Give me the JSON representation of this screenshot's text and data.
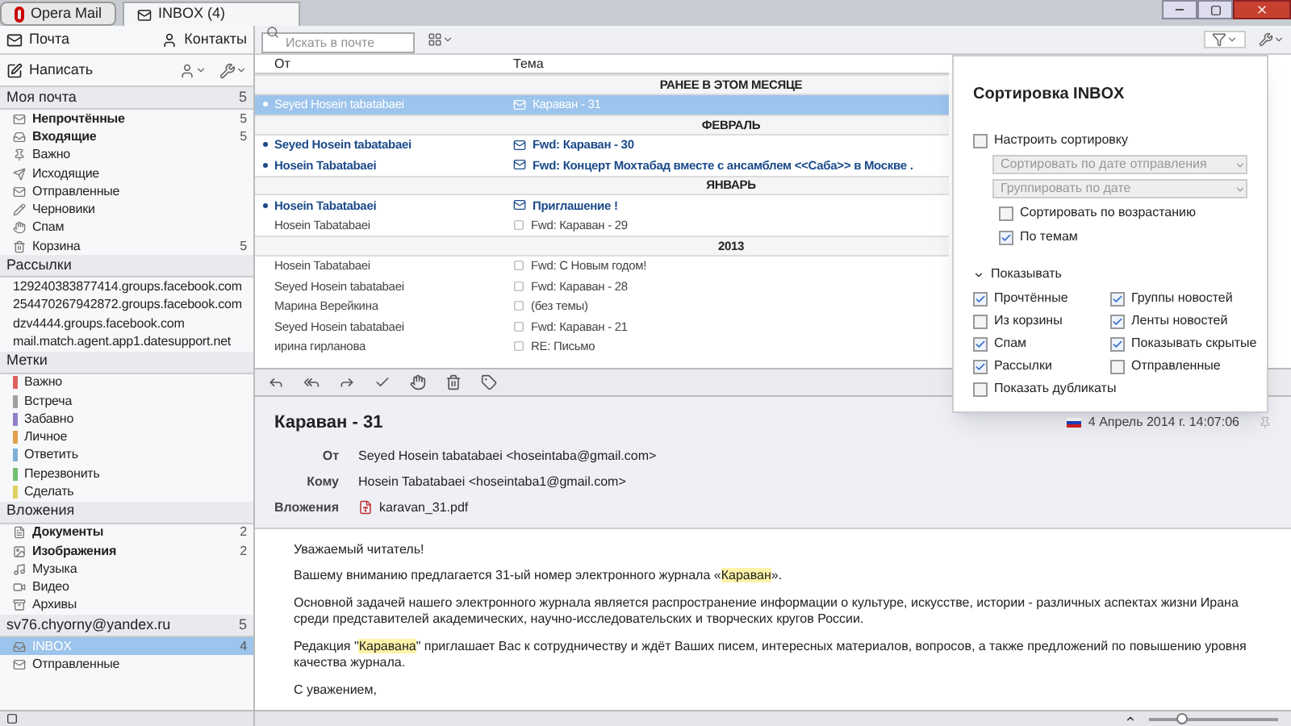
{
  "app_tabs": [
    {
      "label": "Opera Mail",
      "kind": "app"
    },
    {
      "label": "INBOX (4)",
      "kind": "tab"
    }
  ],
  "nav": {
    "mail": "Почта",
    "contacts": "Контакты",
    "compose": "Написать"
  },
  "sidebar": [
    {
      "title": "Моя почта",
      "count": "5",
      "items": [
        {
          "label": "Непрочтённые",
          "bold": true,
          "count": "5",
          "kind": "unread"
        },
        {
          "label": "Входящие",
          "bold": true,
          "count": "5",
          "kind": "inbox"
        },
        {
          "label": "Важно",
          "bold": false,
          "kind": "important"
        },
        {
          "label": "Исходящие",
          "bold": false,
          "kind": "outbox"
        },
        {
          "label": "Отправленные",
          "bold": false,
          "kind": "sent"
        },
        {
          "label": "Черновики",
          "bold": false,
          "kind": "drafts"
        },
        {
          "label": "Спам",
          "bold": false,
          "kind": "spam"
        },
        {
          "label": "Корзина",
          "bold": false,
          "count": "5",
          "kind": "trash"
        }
      ]
    },
    {
      "title": "Рассылки",
      "items": [
        {
          "label": "129240383877414.groups.facebook.com",
          "bold": false
        },
        {
          "label": "254470267942872.groups.facebook.com",
          "bold": false
        },
        {
          "label": "dzv4444.groups.facebook.com",
          "bold": false
        },
        {
          "label": "mail.match.agent.app1.datesupport.net",
          "bold": false
        }
      ]
    },
    {
      "title": "Метки",
      "items": [
        {
          "label": "Важно",
          "bold": false,
          "color": "#e06060"
        },
        {
          "label": "Встреча",
          "bold": false,
          "color": "#a0a0a0"
        },
        {
          "label": "Забавно",
          "bold": false,
          "color": "#9080c8"
        },
        {
          "label": "Личное",
          "bold": false,
          "color": "#e0a050"
        },
        {
          "label": "Ответить",
          "bold": false,
          "color": "#80b0d8"
        },
        {
          "label": "Перезвонить",
          "bold": false,
          "color": "#70c070"
        },
        {
          "label": "Сделать",
          "bold": false,
          "color": "#e0d060"
        }
      ]
    },
    {
      "title": "Вложения",
      "items": [
        {
          "label": "Документы",
          "bold": true,
          "count": "2",
          "kind": "documents"
        },
        {
          "label": "Изображения",
          "bold": true,
          "count": "2",
          "kind": "images"
        },
        {
          "label": "Музыка",
          "bold": false,
          "kind": "music"
        },
        {
          "label": "Видео",
          "bold": false,
          "kind": "video"
        },
        {
          "label": "Архивы",
          "bold": false,
          "kind": "archives"
        }
      ]
    },
    {
      "title": "sv76.chyorny@yandex.ru",
      "count": "5",
      "items": [
        {
          "label": "INBOX",
          "bold": false,
          "count": "4",
          "kind": "inbox",
          "selected": true
        },
        {
          "label": "Отправленные",
          "bold": false,
          "kind": "sent",
          "selected": false
        }
      ]
    }
  ],
  "search": {
    "placeholder": "Искать в почте"
  },
  "columns": [
    "От",
    "Тема"
  ],
  "rows": [
    {
      "kind": "group",
      "label": "РАНЕЕ В ЭТОМ МЕСЯЦЕ"
    },
    {
      "kind": "message",
      "from": "Seyed Hosein tabatabaei",
      "subject": "Караван - 31",
      "unread": true,
      "selected": true
    },
    {
      "kind": "group",
      "label": "ФЕВРАЛЬ"
    },
    {
      "kind": "message",
      "from": "Seyed Hosein tabatabaei",
      "subject": "Fwd: Караван - 30",
      "unread": true,
      "selected": false
    },
    {
      "kind": "message",
      "from": "Hosein Tabatabaei",
      "subject": "Fwd: Концерт Мохтабад вместе с ансамблем <<Саба>> в Москве .",
      "unread": true,
      "selected": false
    },
    {
      "kind": "group",
      "label": "ЯНВАРЬ"
    },
    {
      "kind": "message",
      "from": "Hosein Tabatabaei",
      "subject": "Приглашение !",
      "unread": true,
      "selected": false
    },
    {
      "kind": "message",
      "from": "Hosein Tabatabaei",
      "subject": "Fwd: Караван - 29",
      "unread": false,
      "selected": false
    },
    {
      "kind": "group",
      "label": "2013"
    },
    {
      "kind": "message",
      "from": "Hosein Tabatabaei",
      "subject": "Fwd: С Новым годом!",
      "unread": false,
      "selected": false
    },
    {
      "kind": "message",
      "from": "Seyed Hosein tabatabaei",
      "subject": "Fwd: Караван - 28",
      "unread": false,
      "selected": false
    },
    {
      "kind": "message",
      "from": "Марина Верейкина",
      "subject": "(без темы)",
      "unread": false,
      "selected": false
    },
    {
      "kind": "message",
      "from": "Seyed Hosein tabatabaei",
      "subject": "Fwd: Караван - 21",
      "unread": false,
      "selected": false
    },
    {
      "kind": "message",
      "from": "ирина гирланова",
      "subject": "RE: Письмо",
      "unread": false,
      "selected": false
    }
  ],
  "message": {
    "subject": "Караван - 31",
    "date": "4 Апрель 2014 г. 14:07:06",
    "fields": [
      {
        "label": "От",
        "value": "Seyed Hosein tabatabaei <hoseintaba@gmail.com>"
      },
      {
        "label": "Кому",
        "value": "Hosein Tabatabaei <hoseintaba1@gmail.com>"
      },
      {
        "label": "Вложения",
        "value": "karavan_31.pdf",
        "kind": "attachment"
      }
    ],
    "body": [
      [
        {
          "text": "Уважаемый читатель!"
        }
      ],
      [
        {
          "text": "Вашему вниманию предлагается 31-ый номер электронного журнала «"
        },
        {
          "text": "Караван",
          "highlight": true
        },
        {
          "text": "»."
        }
      ],
      [
        {
          "text": "Основной задачей нашего электронного журнала является распространение информации о культуре, искусстве, истории - различных аспектах жизни Ирана среди представителей академических, научно-исследовательских и творческих кругов России."
        }
      ],
      [
        {
          "text": "Редакция \""
        },
        {
          "text": "Каравана",
          "highlight": true
        },
        {
          "text": "\" приглашает Вас к сотрудничеству и ждёт Ваших писем, интересных материалов, вопросов, а также предложений по повышению уровня качества журнала."
        }
      ],
      [
        {
          "text": "С уважением,"
        }
      ]
    ]
  },
  "sort_popup": {
    "title": "Сортировка INBOX",
    "custom": {
      "label": "Настроить сортировку",
      "checked": false
    },
    "sort_select": "Сортировать по дате отправления",
    "group_select": "Группировать по дате",
    "options": [
      {
        "label": "Сортировать по возрастанию",
        "checked": false
      },
      {
        "label": "По темам",
        "checked": true
      }
    ],
    "show": {
      "label": "Показывать",
      "expanded": true
    },
    "filters": [
      {
        "label": "Прочтённые",
        "checked": true
      },
      {
        "label": "Группы новостей",
        "checked": true
      },
      {
        "label": "Из корзины",
        "checked": false
      },
      {
        "label": "Ленты новостей",
        "checked": true
      },
      {
        "label": "Спам",
        "checked": true
      },
      {
        "label": "Показывать скрытые",
        "checked": true
      },
      {
        "label": "Рассылки",
        "checked": true
      },
      {
        "label": "Отправленные",
        "checked": false
      },
      {
        "label": "Показать дубликаты",
        "checked": false
      }
    ]
  },
  "zoom": {
    "level": 0.25
  }
}
